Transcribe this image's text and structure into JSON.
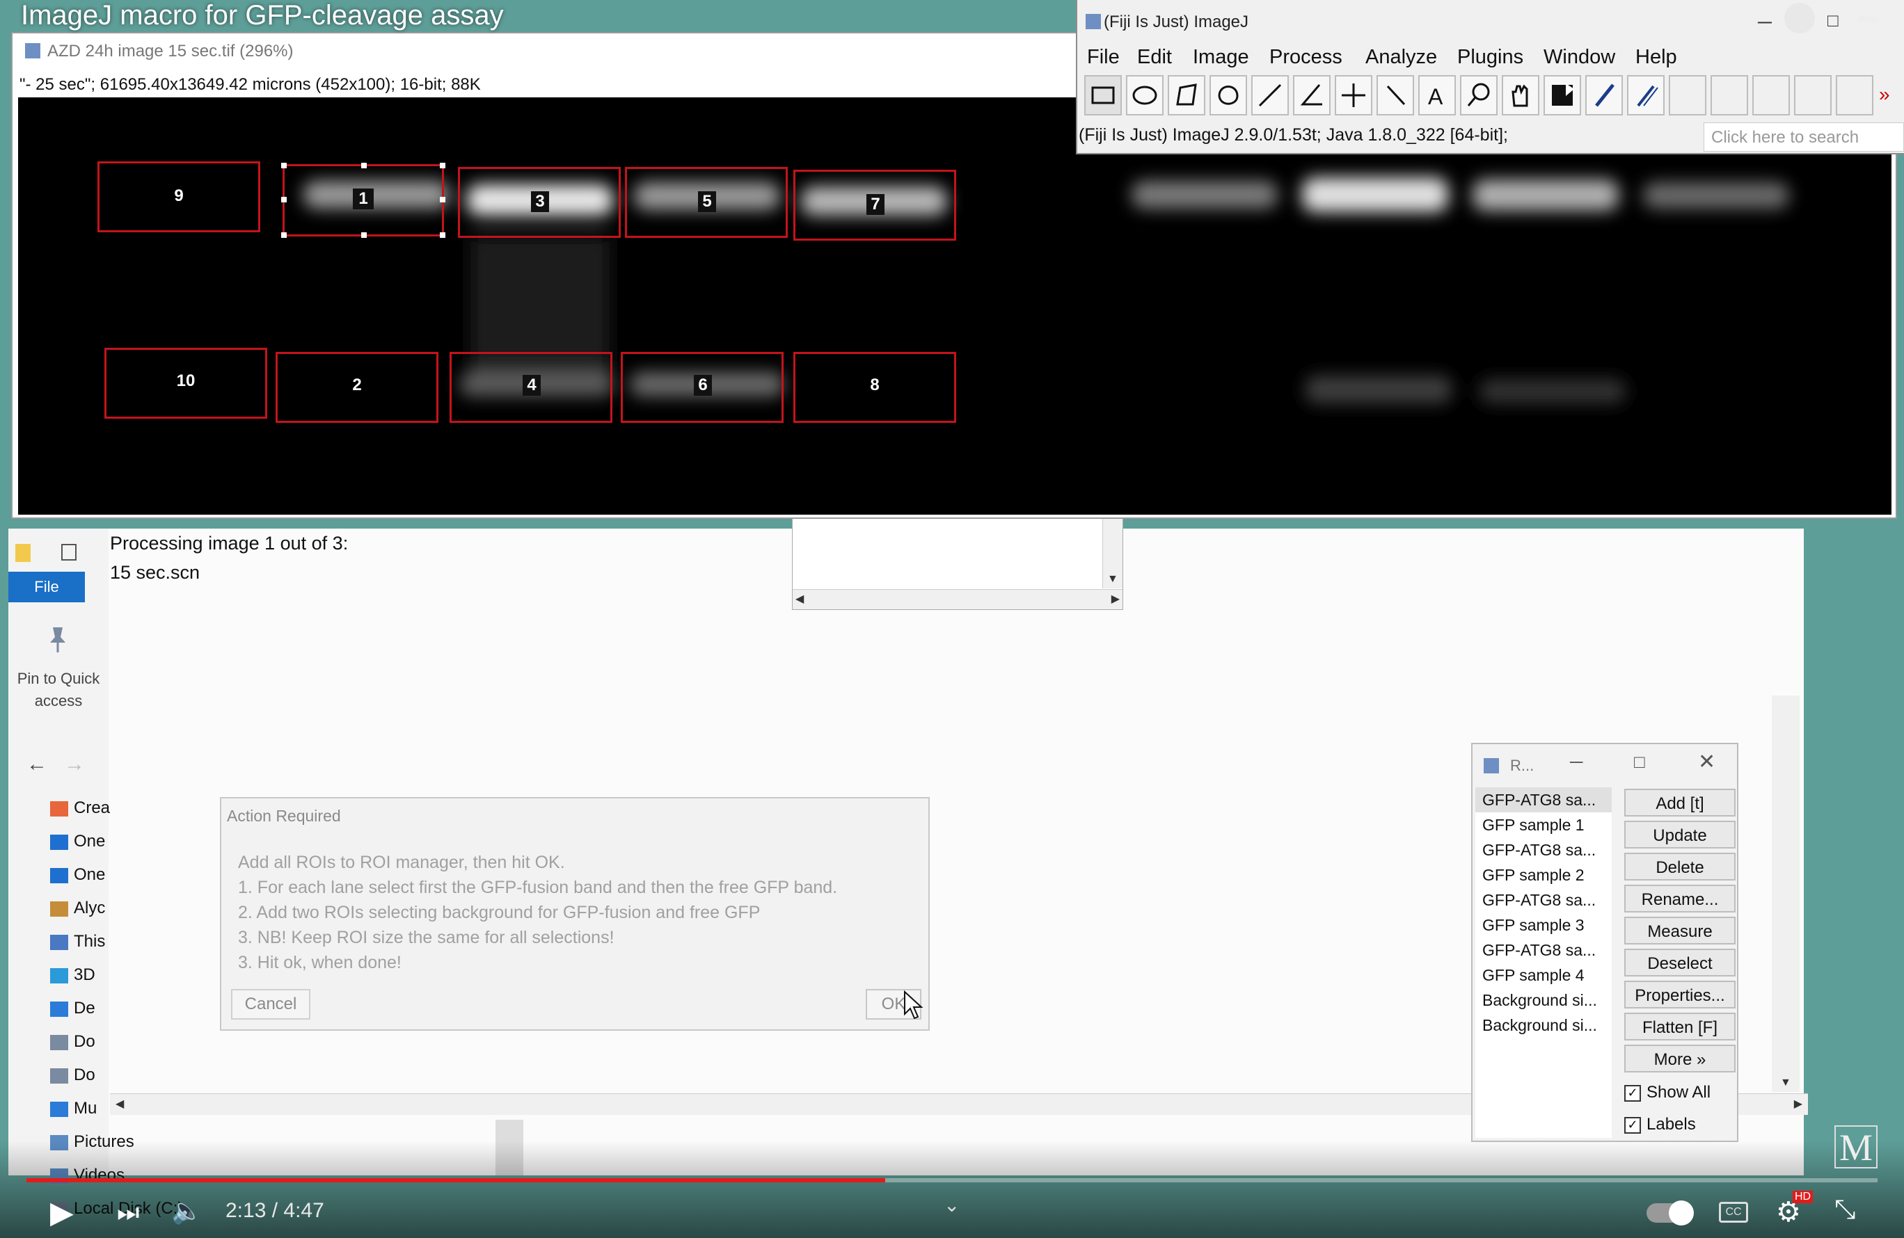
{
  "video": {
    "title": "ImageJ macro for GFP-cleavage assay",
    "time": "2:13 / 4:47",
    "progress_fraction": 0.464,
    "hd_badge": "HD",
    "logo": "M"
  },
  "image_window": {
    "title": "AZD 24h image 15 sec.tif (296%)",
    "info": "\"- 25 sec\"; 61695.40x13649.42 microns (452x100); 16-bit; 88K",
    "rois_top": [
      "9",
      "1",
      "3",
      "5",
      "7"
    ],
    "rois_bottom": [
      "10",
      "2",
      "4",
      "6",
      "8"
    ]
  },
  "fiji": {
    "title": "(Fiji Is Just) ImageJ",
    "menu": [
      "File",
      "Edit",
      "Image",
      "Process",
      "Analyze",
      "Plugins",
      "Window",
      "Help"
    ],
    "status": "(Fiji Is Just) ImageJ 2.9.0/1.53t; Java 1.8.0_322 [64-bit];",
    "search_placeholder": "Click here to search",
    "tools": [
      "rectangle-tool-icon",
      "oval-tool-icon",
      "polygon-tool-icon",
      "freehand-tool-icon",
      "line-tool-icon",
      "angle-tool-icon",
      "point-tool-icon",
      "wand-tool-icon",
      "text-tool-icon",
      "magnifier-tool-icon",
      "hand-tool-icon",
      "color-picker-icon",
      "brush-tool-icon",
      "pencil-tool-icon"
    ]
  },
  "explorer": {
    "file_tab": "File",
    "pin_label_1": "Pin to Quick",
    "pin_label_2": "access",
    "nav_items": [
      "Crea",
      "One",
      "One",
      "Alyc",
      "This",
      "3D",
      "De",
      "Do",
      "Do",
      "Mu",
      "Pictures",
      "Videos",
      "Local Disk (C:)"
    ]
  },
  "log": {
    "line1": "Processing image 1 out of 3:",
    "line2": "15 sec.scn"
  },
  "dialog": {
    "title": "Action Required",
    "lines": [
      "Add all ROIs to ROI manager, then hit OK.",
      "1. For each lane select first the GFP-fusion band and then the free GFP band.",
      "2. Add two ROIs selecting background for GFP-fusion and free GFP",
      "3. NB! Keep ROI size the same for all selections!",
      "3. Hit ok, when done!"
    ],
    "cancel": "Cancel",
    "ok": "OK"
  },
  "roi_manager": {
    "title": "R...",
    "items": [
      "GFP-ATG8 sa...",
      "GFP sample 1",
      "GFP-ATG8 sa...",
      "GFP sample 2",
      "GFP-ATG8 sa...",
      "GFP sample 3",
      "GFP-ATG8 sa...",
      "GFP sample 4",
      "Background si...",
      "Background si..."
    ],
    "buttons": [
      "Add [t]",
      "Update",
      "Delete",
      "Rename...",
      "Measure",
      "Deselect",
      "Properties...",
      "Flatten [F]",
      "More »"
    ],
    "show_all": "Show All",
    "labels": "Labels"
  }
}
